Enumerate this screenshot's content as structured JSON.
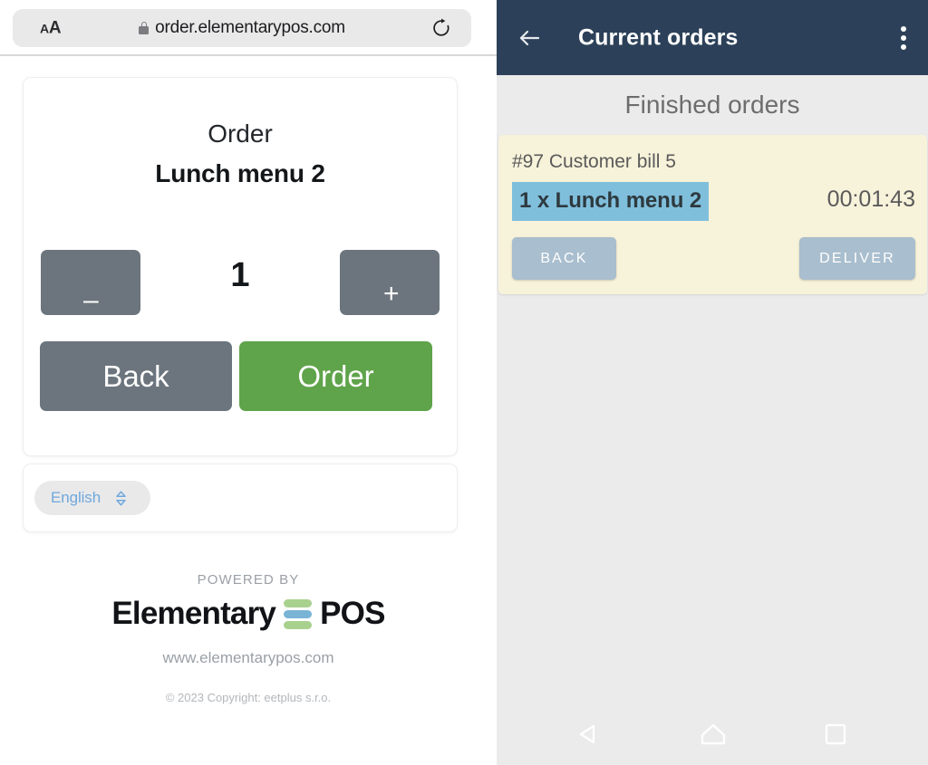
{
  "browser": {
    "text_size_small": "A",
    "text_size_large": "A",
    "lock_icon": "lock-icon",
    "url": "order.elementarypos.com",
    "reload_icon": "reload-icon"
  },
  "web_order": {
    "order_label": "Order",
    "product_name": "Lunch menu 2",
    "minus_label": "–",
    "plus_label": "+",
    "quantity": "1",
    "back_label": "Back",
    "order_label_button": "Order",
    "colors": {
      "secondary": "#6c757d",
      "primary_green": "#5fa34a"
    }
  },
  "language": {
    "selected": "English",
    "chevron_icon": "chevron-up-down-icon"
  },
  "footer": {
    "powered_by": "POWERED BY",
    "brand_first": "Elementary",
    "brand_second": "POS",
    "logo_bar_colors": [
      "#a9d18e",
      "#79b4d6",
      "#a9d18e"
    ],
    "site_url": "www.elementarypos.com",
    "copyright": "© 2023 Copyright: eetplus s.r.o."
  },
  "app": {
    "back_icon": "arrow-left-icon",
    "title": "Current orders",
    "overflow_icon": "more-vertical-icon",
    "section_title": "Finished orders",
    "appbar_color": "#2c4159"
  },
  "order_row": {
    "bill_label": "#97 Customer bill 5",
    "item_line": "1 x Lunch menu 2",
    "timer": "00:01:43",
    "back_label": "BACK",
    "deliver_label": "DELIVER",
    "card_color": "#f7f2da",
    "highlight_color": "#80bfdc",
    "button_color": "#a9bece"
  },
  "nav": {
    "back_icon": "triangle-back-icon",
    "home_icon": "home-icon",
    "recents_icon": "square-recents-icon"
  }
}
